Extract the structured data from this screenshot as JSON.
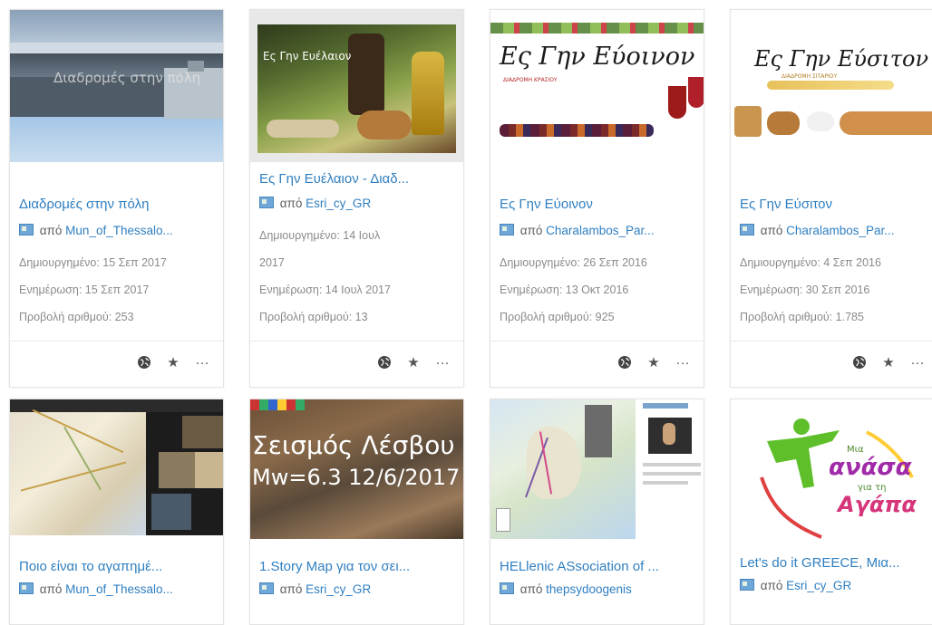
{
  "cards": [
    {
      "title": "Διαδρομές στην πόλη",
      "by": "από",
      "owner": "Mun_of_Thessalo...",
      "created": "Δημιουργημένο: 15 Σεπ 2017",
      "updated": "Ενημέρωση: 15 Σεπ 2017",
      "views": "Προβολή αριθμού: 253",
      "thumb_text": "Διαδρομές στην πόλη"
    },
    {
      "title": "Ες Γην Ευέλαιον - Διαδ...",
      "by": "από",
      "owner": "Esri_cy_GR",
      "created_line1": "Δημιουργημένο: 14 Ιουλ",
      "created_line2": "2017",
      "updated": "Ενημέρωση: 14 Ιουλ 2017",
      "views": "Προβολή αριθμού: 13",
      "thumb_text": "Ες Γην Ευέλαιον"
    },
    {
      "title": "Ες Γην Εύοινον",
      "by": "από",
      "owner": "Charalambos_Par...",
      "created": "Δημιουργημένο: 26 Σεπ 2016",
      "updated": "Ενημέρωση: 13 Οκτ 2016",
      "views": "Προβολή αριθμού: 925",
      "thumb_title": "Ες Γην Εύοινον",
      "thumb_sub": "ΔΙΑΔΡΟΜΗ ΚΡΑΣΙΟΥ"
    },
    {
      "title": "Ες Γην Εύσιτον",
      "by": "από",
      "owner": "Charalambos_Par...",
      "created": "Δημιουργημένο: 4 Σεπ 2016",
      "updated": "Ενημέρωση: 30 Σεπ 2016",
      "views": "Προβολή αριθμού: 1.785",
      "thumb_title": "Ες Γην Εύσιτον",
      "thumb_sub": "ΔΙΑΔΡΟΜΗ ΣΙΤΑΡΙΟΥ"
    },
    {
      "title": "Ποιο είναι το αγαπημέ...",
      "by": "από",
      "owner": "Mun_of_Thessalo..."
    },
    {
      "title": "1.Story Map για τον σει...",
      "by": "από",
      "owner": "Esri_cy_GR",
      "thumb_line1": "Σεισμός Λέσβου",
      "thumb_line2": "Mw=6.3 12/6/2017"
    },
    {
      "title": "HELlenic ASsociation of ...",
      "by": "από",
      "owner": "thepsydoogenis"
    },
    {
      "title": "Let's do it GREECE, Μια...",
      "by": "από",
      "owner": "Esri_cy_GR",
      "logo_line1": "Μια",
      "logo_line2": "ανάσα",
      "logo_line3": "για τη",
      "logo_line4": "Αγάπα"
    }
  ]
}
